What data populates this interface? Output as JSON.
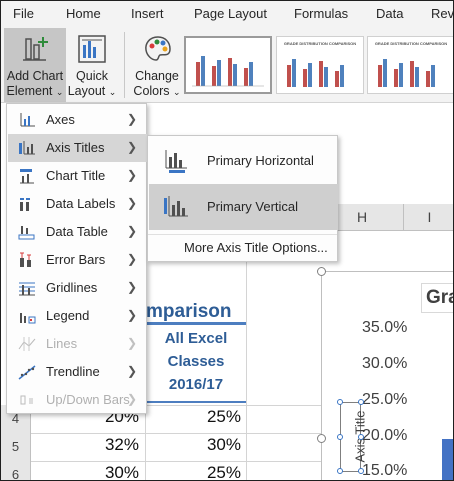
{
  "menubar": {
    "tabs": [
      "File",
      "Home",
      "Insert",
      "Page Layout",
      "Formulas",
      "Data",
      "Rev"
    ]
  },
  "ribbon": {
    "add_chart_element": [
      "Add Chart",
      "Element"
    ],
    "quick_layout": [
      "Quick",
      "Layout"
    ],
    "change_colors": [
      "Change",
      "Colors"
    ],
    "style_titles": [
      "",
      "GRADE DISTRIBUTION COMPARISON",
      "GRADE DISTRIBUTION COMPARISON"
    ]
  },
  "dropdown": {
    "items": [
      {
        "label": "Axes",
        "icon": "axes-icon",
        "disabled": false
      },
      {
        "label": "Axis Titles",
        "icon": "axis-titles-icon",
        "disabled": false
      },
      {
        "label": "Chart Title",
        "icon": "chart-title-icon",
        "disabled": false
      },
      {
        "label": "Data Labels",
        "icon": "data-labels-icon",
        "disabled": false
      },
      {
        "label": "Data Table",
        "icon": "data-table-icon",
        "disabled": false
      },
      {
        "label": "Error Bars",
        "icon": "error-bars-icon",
        "disabled": false
      },
      {
        "label": "Gridlines",
        "icon": "gridlines-icon",
        "disabled": false
      },
      {
        "label": "Legend",
        "icon": "legend-icon",
        "disabled": false
      },
      {
        "label": "Lines",
        "icon": "lines-icon",
        "disabled": true
      },
      {
        "label": "Trendline",
        "icon": "trendline-icon",
        "disabled": false
      },
      {
        "label": "Up/Down Bars",
        "icon": "up-down-bars-icon",
        "disabled": true
      }
    ]
  },
  "submenu": {
    "primary_horizontal": "Primary Horizontal",
    "primary_vertical": "Primary Vertical",
    "more_options": "More Axis Title Options..."
  },
  "sheet": {
    "col_h": "H",
    "col_i": "I",
    "title_fragment": "mparison",
    "header_lines": [
      "All Excel",
      "Classes",
      "2016/17"
    ],
    "rows": [
      {
        "num": "4",
        "b": "20%",
        "c": "25%"
      },
      {
        "num": "5",
        "b": "32%",
        "c": "30%"
      },
      {
        "num": "6",
        "b": "30%",
        "c": "25%"
      }
    ]
  },
  "chart": {
    "title_fragment": "Gra",
    "y_ticks": [
      "35.0%",
      "30.0%",
      "25.0%",
      "20.0%",
      "15.0%"
    ],
    "axis_title": "Axis Title",
    "bar_color": "#4472c4"
  },
  "colors": {
    "accent_blue": "#2e5d96",
    "menu_hover": "#d6d6d6"
  }
}
